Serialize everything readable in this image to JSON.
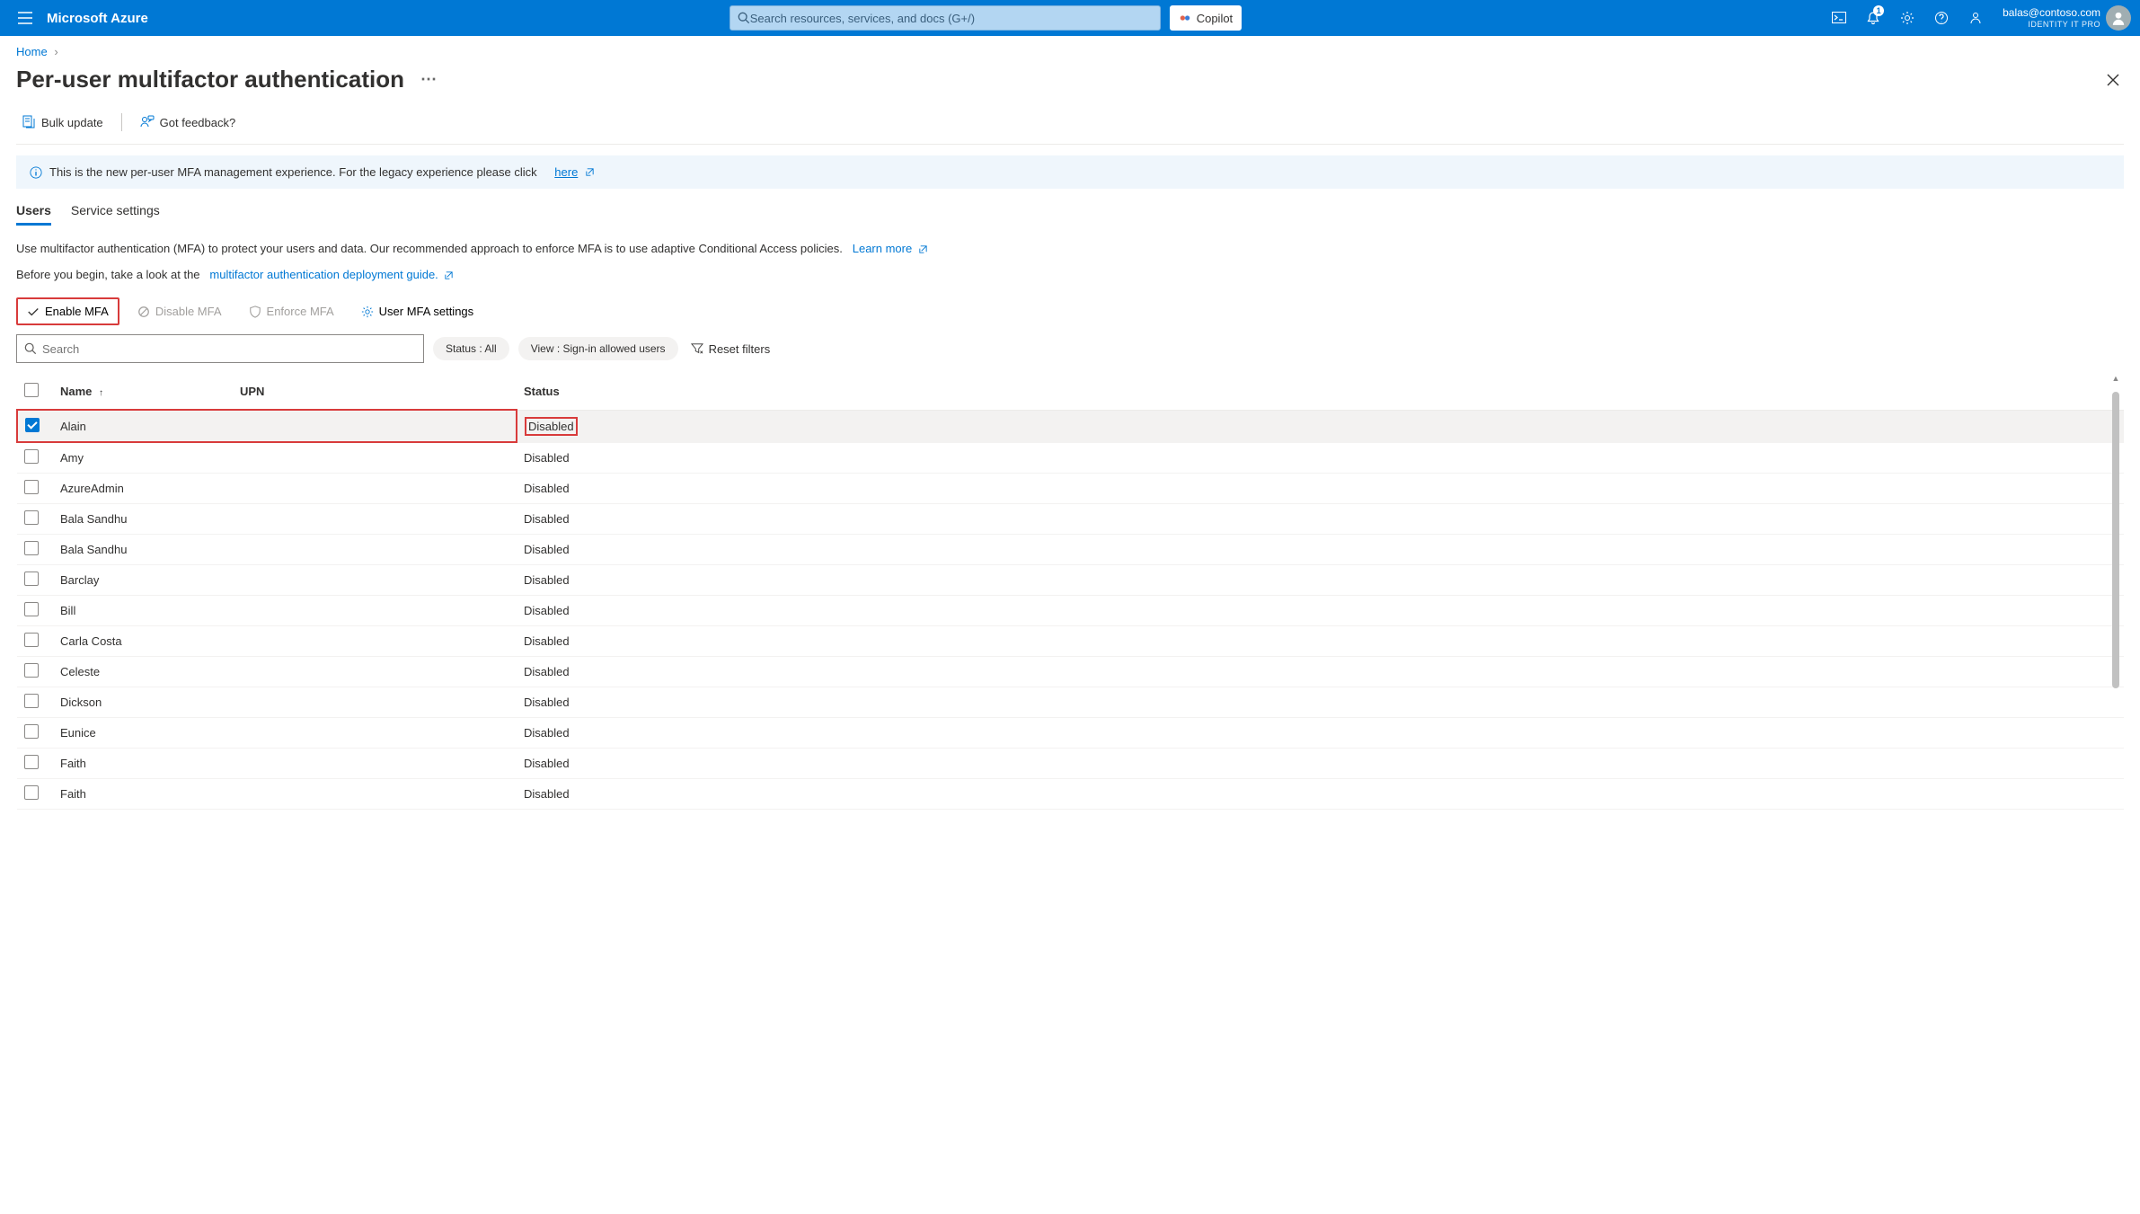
{
  "header": {
    "brand": "Microsoft Azure",
    "search_placeholder": "Search resources, services, and docs (G+/)",
    "copilot": "Copilot",
    "notification_count": "1",
    "account_email": "balas@contoso.com",
    "account_role": "IDENTITY IT PRO"
  },
  "breadcrumb": {
    "home": "Home"
  },
  "page": {
    "title": "Per-user multifactor authentication"
  },
  "toolbar": {
    "bulk_update": "Bulk update",
    "feedback": "Got feedback?"
  },
  "banner": {
    "text": "This is the new per-user MFA management experience. For the legacy experience please click",
    "link": "here"
  },
  "tabs": {
    "users": "Users",
    "service_settings": "Service settings"
  },
  "desc1": {
    "text": "Use multifactor authentication (MFA) to protect your users and data. Our recommended approach to enforce MFA is to use adaptive Conditional Access policies.",
    "link": "Learn more"
  },
  "desc2": {
    "text": "Before you begin, take a look at the",
    "link": "multifactor authentication deployment guide."
  },
  "actions": {
    "enable": "Enable MFA",
    "disable": "Disable MFA",
    "enforce": "Enforce MFA",
    "settings": "User MFA settings"
  },
  "filters": {
    "search_placeholder": "Search",
    "status_pill": "Status : All",
    "view_pill": "View : Sign-in allowed users",
    "reset": "Reset filters"
  },
  "table": {
    "col_name": "Name",
    "col_upn": "UPN",
    "col_status": "Status",
    "rows": [
      {
        "name": "Alain",
        "upn": "",
        "status": "Disabled",
        "checked": true,
        "highlighted": true
      },
      {
        "name": "Amy",
        "upn": "",
        "status": "Disabled",
        "checked": false
      },
      {
        "name": "AzureAdmin",
        "upn": "",
        "status": "Disabled",
        "checked": false
      },
      {
        "name": "Bala Sandhu",
        "upn": "",
        "status": "Disabled",
        "checked": false
      },
      {
        "name": "Bala Sandhu",
        "upn": "",
        "status": "Disabled",
        "checked": false
      },
      {
        "name": "Barclay",
        "upn": "",
        "status": "Disabled",
        "checked": false
      },
      {
        "name": "Bill",
        "upn": "",
        "status": "Disabled",
        "checked": false
      },
      {
        "name": "Carla Costa",
        "upn": "",
        "status": "Disabled",
        "checked": false
      },
      {
        "name": "Celeste",
        "upn": "",
        "status": "Disabled",
        "checked": false
      },
      {
        "name": "Dickson",
        "upn": "",
        "status": "Disabled",
        "checked": false
      },
      {
        "name": "Eunice",
        "upn": "",
        "status": "Disabled",
        "checked": false
      },
      {
        "name": "Faith",
        "upn": "",
        "status": "Disabled",
        "checked": false
      },
      {
        "name": "Faith",
        "upn": "",
        "status": "Disabled",
        "checked": false
      }
    ]
  }
}
